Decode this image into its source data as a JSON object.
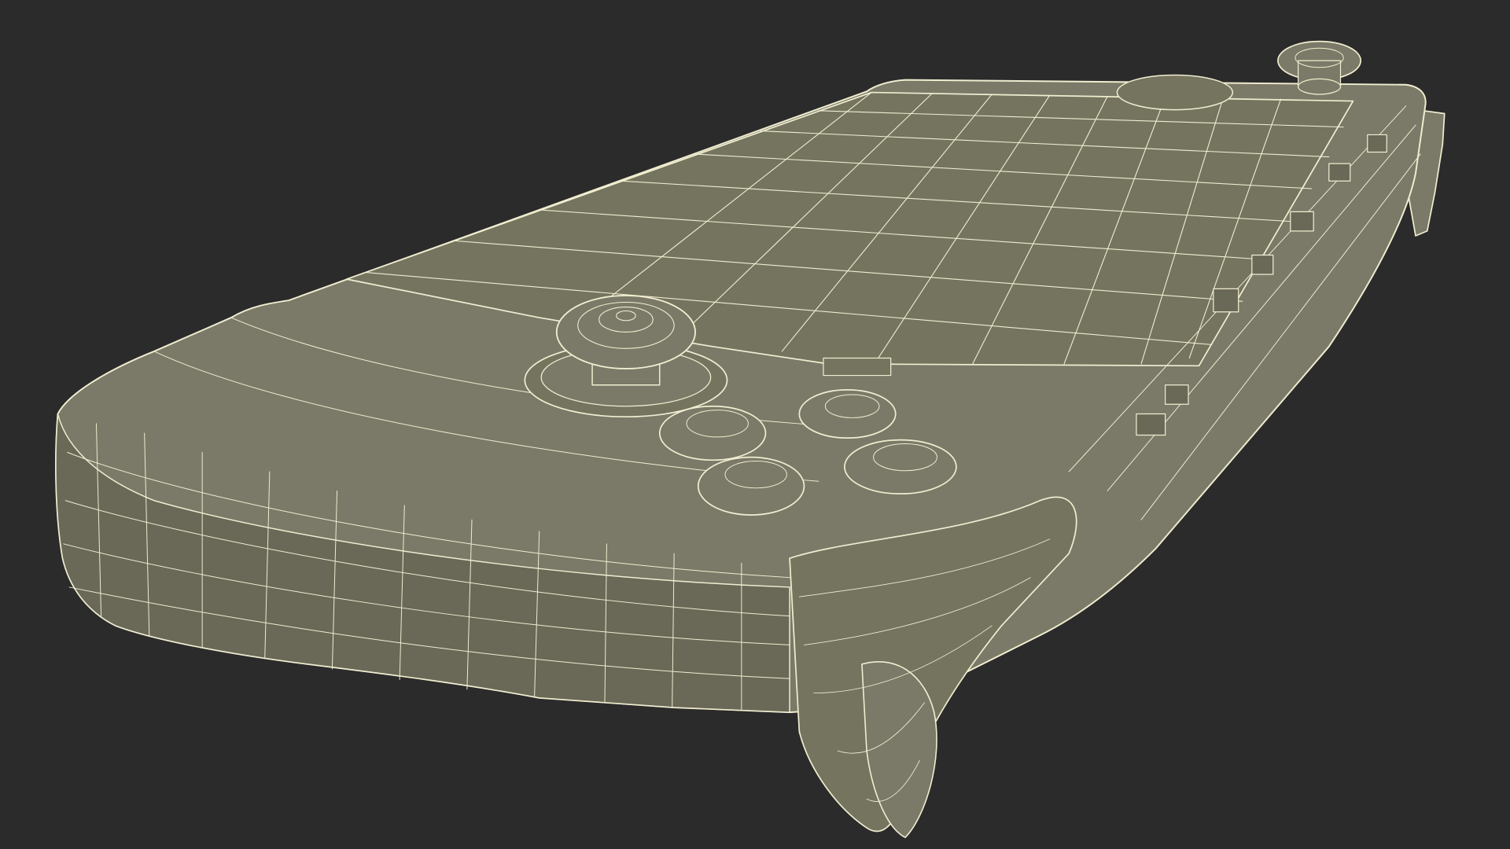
{
  "scene": {
    "subject": "handheld-game-console-wireframe",
    "background_color": "#2b2b2b",
    "surface_color": "#7b7a68",
    "surface_shadow_color": "#6a6958",
    "wire_color": "#f0edd0"
  }
}
